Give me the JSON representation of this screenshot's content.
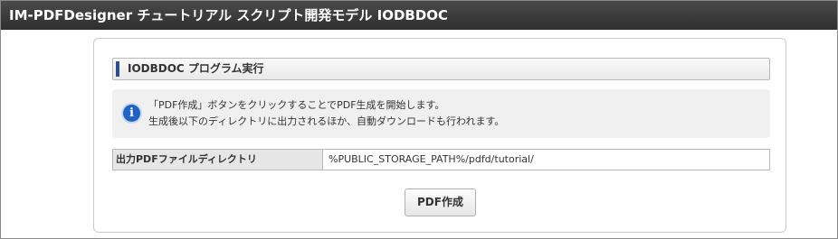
{
  "window": {
    "title": "IM-PDFDesigner チュートリアル スクリプト開発モデル IODBDOC"
  },
  "section": {
    "title": "IODBDOC プログラム実行"
  },
  "info": {
    "icon": "info-icon",
    "line1": "「PDF作成」ボタンをクリックすることでPDF生成を開始します。",
    "line2": "生成後以下のディレクトリに出力されるほか、自動ダウンロードも行われます。"
  },
  "form": {
    "output_dir_label": "出力PDFファイルディレクトリ",
    "output_dir_value": "%PUBLIC_STORAGE_PATH%/pdfd/tutorial/"
  },
  "actions": {
    "create_pdf_label": "PDF作成"
  },
  "colors": {
    "titlebar": "#3a3a3a",
    "accent_bar": "#2b4f8f",
    "info_icon": "#1f63c6"
  }
}
